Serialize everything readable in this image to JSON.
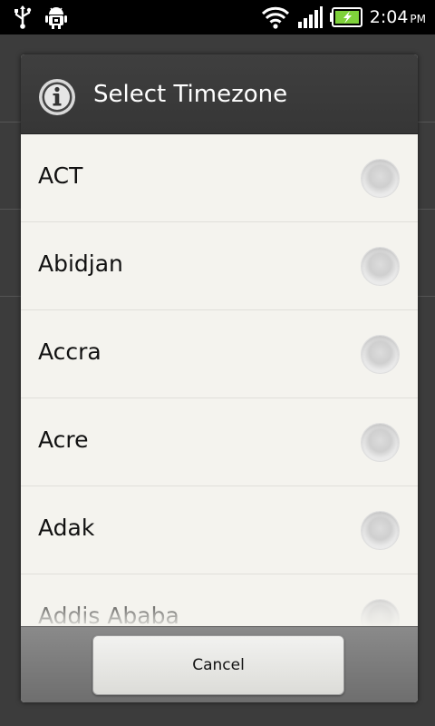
{
  "status_bar": {
    "time": "2:04",
    "ampm": "PM",
    "icons": [
      "usb-icon",
      "android-debug-icon",
      "wifi-icon",
      "signal-icon",
      "battery-charging-icon"
    ]
  },
  "dialog": {
    "title": "Select Timezone",
    "title_icon": "info-icon",
    "items": [
      {
        "label": "ACT",
        "selected": false
      },
      {
        "label": "Abidjan",
        "selected": false
      },
      {
        "label": "Accra",
        "selected": false
      },
      {
        "label": "Acre",
        "selected": false
      },
      {
        "label": "Adak",
        "selected": false
      },
      {
        "label": "Addis Ababa",
        "selected": false
      }
    ],
    "cancel_label": "Cancel"
  },
  "colors": {
    "header_bg": "#3a3a3a",
    "list_bg": "#f4f3ee",
    "footer_bg": "#7a7a7a",
    "battery_accent": "#7fd13b"
  }
}
